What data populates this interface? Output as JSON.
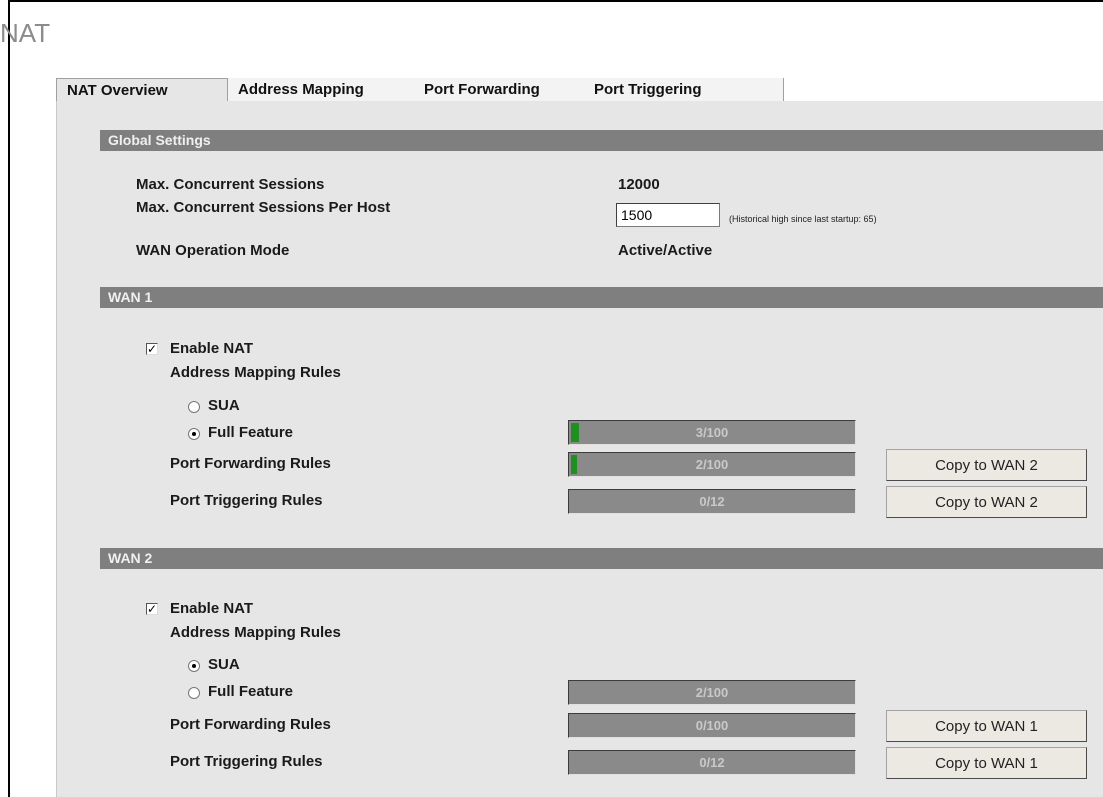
{
  "page": {
    "title": "NAT"
  },
  "tabs": [
    {
      "label": "NAT Overview",
      "active": true
    },
    {
      "label": "Address Mapping",
      "active": false
    },
    {
      "label": "Port Forwarding",
      "active": false
    },
    {
      "label": "Port Triggering",
      "active": false
    }
  ],
  "global": {
    "header": "Global Settings",
    "max_sessions_label": "Max. Concurrent Sessions",
    "max_sessions_value": "12000",
    "per_host_label": "Max. Concurrent Sessions Per Host",
    "per_host_value": "1500",
    "per_host_note": "(Historical high since last startup: 65)",
    "wan_mode_label": "WAN Operation Mode",
    "wan_mode_value": "Active/Active"
  },
  "wan1": {
    "header": "WAN 1",
    "enable_nat_label": "Enable NAT",
    "enable_nat_checked": true,
    "mapping_label": "Address Mapping Rules",
    "sua_label": "SUA",
    "full_feature_label": "Full Feature",
    "selected_mode": "Full Feature",
    "mapping_usage": "3/100",
    "mapping_fraction": 0.03,
    "port_forwarding_label": "Port Forwarding Rules",
    "port_forwarding_usage": "2/100",
    "port_forwarding_fraction": 0.02,
    "port_triggering_label": "Port Triggering Rules",
    "port_triggering_usage": "0/12",
    "port_triggering_fraction": 0,
    "copy_pf_label": "Copy to WAN 2",
    "copy_pt_label": "Copy to WAN 2",
    "fill_color": "#1f8f1f"
  },
  "wan2": {
    "header": "WAN 2",
    "enable_nat_label": "Enable NAT",
    "enable_nat_checked": true,
    "mapping_label": "Address Mapping Rules",
    "sua_label": "SUA",
    "full_feature_label": "Full Feature",
    "selected_mode": "SUA",
    "mapping_usage": "2/100",
    "port_forwarding_label": "Port Forwarding Rules",
    "port_forwarding_usage": "0/100",
    "port_triggering_label": "Port Triggering Rules",
    "port_triggering_usage": "0/12",
    "copy_pf_label": "Copy to WAN 1",
    "copy_pt_label": "Copy to WAN 1"
  }
}
